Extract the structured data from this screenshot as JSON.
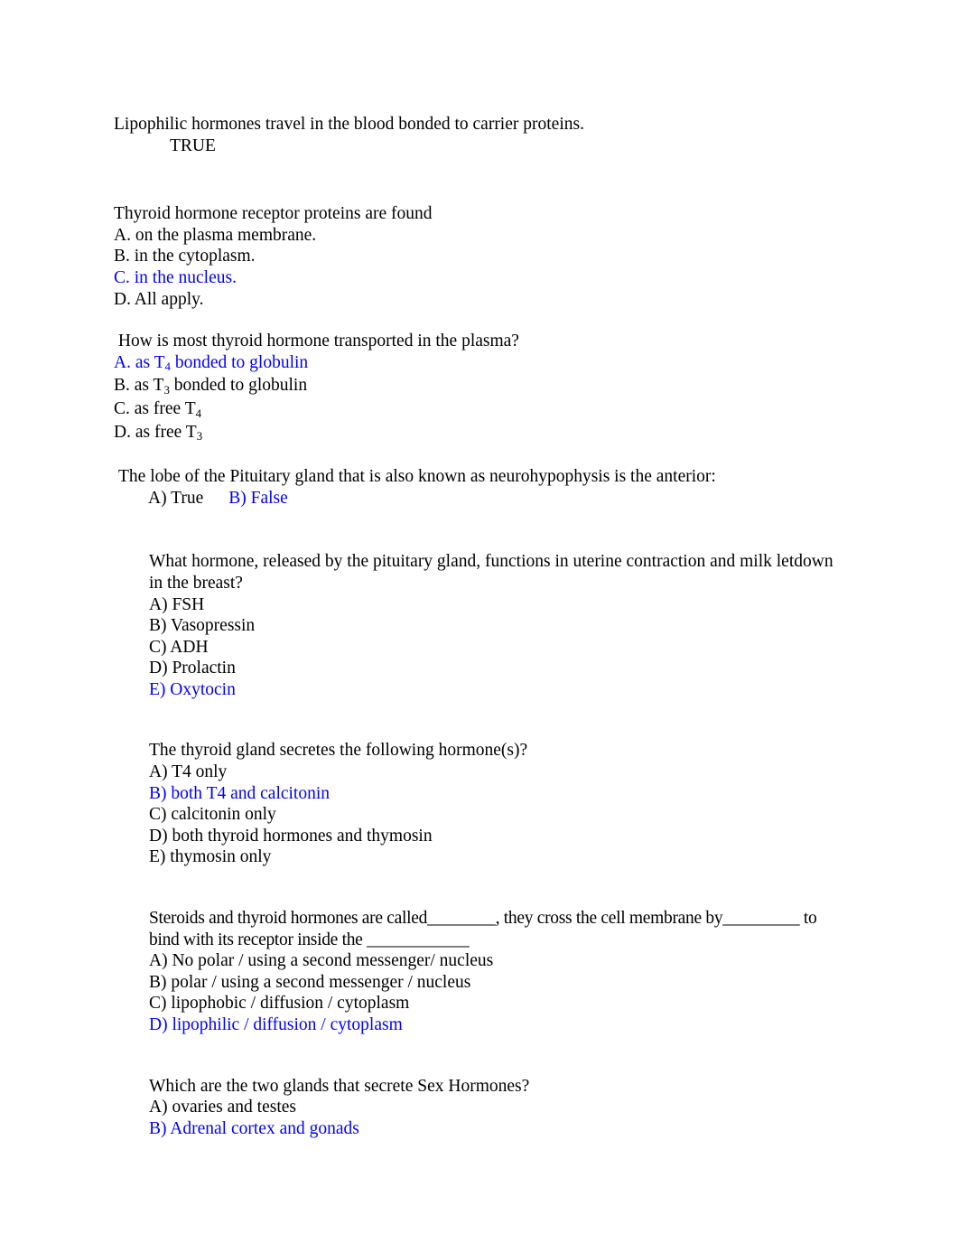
{
  "document": {
    "answer_color": "#0000ff",
    "text_color": "#000000",
    "background_color": "#ffffff",
    "questions": [
      {
        "id": "q1",
        "prompt": "Lipophilic hormones travel in the blood bonded to carrier proteins.",
        "answer_line": "TRUE"
      },
      {
        "id": "q2",
        "prompt": "Thyroid hormone receptor proteins are found",
        "options": [
          "A. on the plasma membrane.",
          "B. in the cytoplasm.",
          "C. in the nucleus.",
          "D. All apply."
        ],
        "correct_index": 2
      },
      {
        "id": "q3",
        "prompt": " How is most thyroid hormone transported in the plasma?",
        "options_parts": [
          {
            "pre": "A. as T",
            "sub": "4",
            "post": " bonded to globulin"
          },
          {
            "pre": "B. as T",
            "sub": "3",
            "post": " bonded to globulin"
          },
          {
            "pre": "C. as free T",
            "sub": "4",
            "post": ""
          },
          {
            "pre": "D. as free T",
            "sub": "3",
            "post": ""
          }
        ],
        "correct_index": 0
      },
      {
        "id": "q4",
        "prompt": "The lobe of the Pituitary gland that is also known as neurohypophysis is the anterior:",
        "true_label": "A) True",
        "false_label": "B) False",
        "correct": "false"
      },
      {
        "id": "q5",
        "prompt": "What hormone, released by the pituitary gland, functions in uterine contraction and milk letdown in the breast?",
        "options": [
          "A) FSH",
          "B) Vasopressin",
          "C) ADH",
          "D) Prolactin",
          "E) Oxytocin"
        ],
        "correct_index": 4
      },
      {
        "id": "q6",
        "prompt": "The thyroid gland secretes the following hormone(s)?",
        "options": [
          "A) T4 only",
          "B) both T4 and calcitonin",
          "C) calcitonin only",
          "D) both thyroid hormones and thymosin",
          "E) thymosin only"
        ],
        "correct_index": 1
      },
      {
        "id": "q7",
        "prompt_line1": "Steroids and thyroid hormones are called________, they cross the cell membrane by_________ to",
        "prompt_line2": "bind with its receptor inside the ____________",
        "options": [
          "A) No polar / using a second messenger/ nucleus",
          "B) polar / using a second messenger / nucleus",
          "C) lipophobic / diffusion / cytoplasm",
          "D) lipophilic / diffusion / cytoplasm"
        ],
        "correct_index": 3
      },
      {
        "id": "q8",
        "prompt": "Which are the two glands that secrete Sex Hormones?",
        "options": [
          "A) ovaries and testes",
          "B) Adrenal cortex and gonads"
        ],
        "correct_index": 1
      }
    ]
  }
}
